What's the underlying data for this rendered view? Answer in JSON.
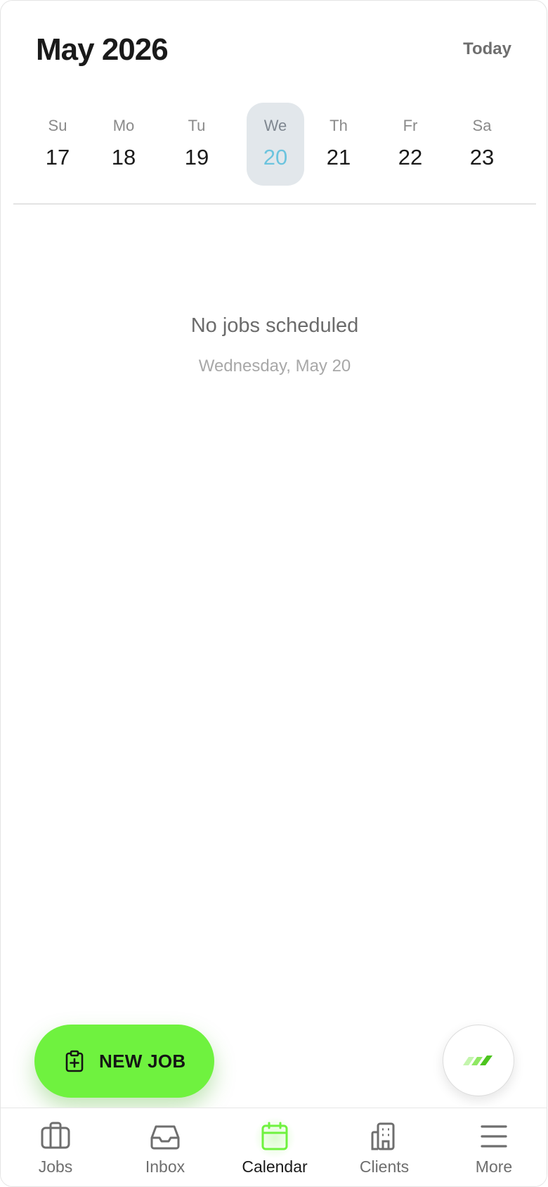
{
  "header": {
    "title": "May 2026",
    "today_label": "Today"
  },
  "week": {
    "days": [
      {
        "name": "Su",
        "num": "17"
      },
      {
        "name": "Mo",
        "num": "18"
      },
      {
        "name": "Tu",
        "num": "19"
      },
      {
        "name": "We",
        "num": "20"
      },
      {
        "name": "Th",
        "num": "21"
      },
      {
        "name": "Fr",
        "num": "22"
      },
      {
        "name": "Sa",
        "num": "23"
      }
    ],
    "selected_index": 3
  },
  "empty_state": {
    "title": "No jobs scheduled",
    "date": "Wednesday, May 20"
  },
  "fab": {
    "new_job_label": "NEW JOB",
    "new_job_icon": "clipboard-plus-icon",
    "logo_icon": "brand-logo-icon"
  },
  "tabbar": {
    "tabs": [
      {
        "label": "Jobs",
        "icon": "briefcase-icon"
      },
      {
        "label": "Inbox",
        "icon": "inbox-icon"
      },
      {
        "label": "Calendar",
        "icon": "calendar-icon"
      },
      {
        "label": "Clients",
        "icon": "building-icon"
      },
      {
        "label": "More",
        "icon": "menu-icon"
      }
    ],
    "active_index": 2
  },
  "colors": {
    "accent_green": "#6ff23f",
    "selected_day_bg": "#e2e7eb",
    "selected_day_num": "#6cc4de",
    "text_dark": "#1a1a1a",
    "text_muted": "#6e6e6e"
  }
}
